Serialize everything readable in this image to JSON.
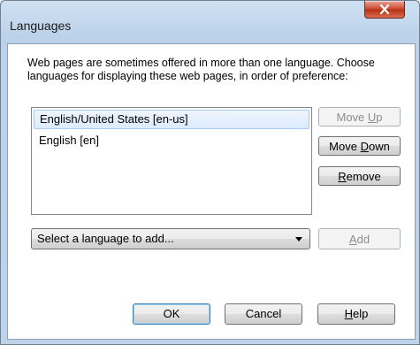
{
  "window": {
    "title": "Languages"
  },
  "description": "Web pages are sometimes offered in more than one language. Choose languages for displaying these web pages, in order of preference:",
  "languages": [
    {
      "label": "English/United States  [en-us]",
      "selected": true
    },
    {
      "label": "English  [en]",
      "selected": false
    }
  ],
  "buttons": {
    "move_up": {
      "pre": "Move ",
      "key": "U",
      "post": "p",
      "enabled": false
    },
    "move_down": {
      "pre": "Move ",
      "key": "D",
      "post": "own",
      "enabled": true
    },
    "remove": {
      "pre": "",
      "key": "R",
      "post": "emove",
      "enabled": true
    },
    "add": {
      "pre": "",
      "key": "A",
      "post": "dd",
      "enabled": false
    },
    "ok": {
      "label": "OK"
    },
    "cancel": {
      "label": "Cancel"
    },
    "help": {
      "pre": "",
      "key": "H",
      "post": "elp"
    }
  },
  "add_dropdown": {
    "value": "Select a language to add..."
  },
  "icons": {
    "close": "close-icon",
    "dropdown_arrow": "chevron-down-icon"
  }
}
